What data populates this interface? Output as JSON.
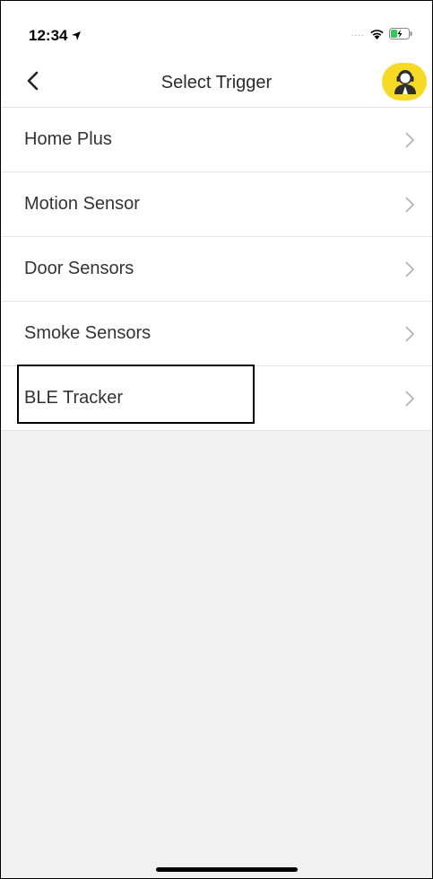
{
  "status_bar": {
    "time": "12:34",
    "signal_dots": "....",
    "icons": [
      "location-arrow-icon",
      "wifi-icon",
      "battery-charging-icon"
    ]
  },
  "nav": {
    "title": "Select Trigger",
    "back_icon": "chevron-left-icon",
    "support_icon": "support-agent-icon",
    "support_color": "#F6DA25"
  },
  "triggers": [
    {
      "label": "Home Plus"
    },
    {
      "label": "Motion Sensor"
    },
    {
      "label": "Door Sensors"
    },
    {
      "label": "Smoke Sensors"
    },
    {
      "label": "BLE Tracker",
      "highlighted": true
    }
  ]
}
